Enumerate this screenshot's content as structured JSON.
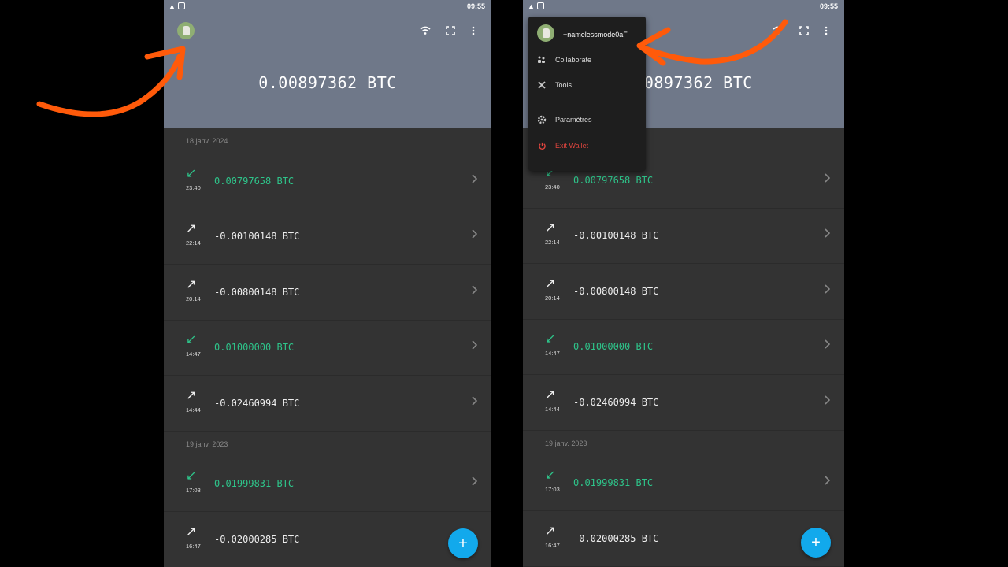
{
  "status_bar": {
    "time": "09:55"
  },
  "balance": "0.00897362 BTC",
  "transactions": [
    {
      "date": "18 janv. 2024"
    },
    {
      "direction": "in",
      "time": "23:40",
      "amount": "0.00797658 BTC"
    },
    {
      "direction": "out",
      "time": "22:14",
      "amount": "-0.00100148 BTC"
    },
    {
      "direction": "out",
      "time": "20:14",
      "amount": "-0.00800148 BTC"
    },
    {
      "direction": "in",
      "time": "14:47",
      "amount": "0.01000000 BTC"
    },
    {
      "direction": "out",
      "time": "14:44",
      "amount": "-0.02460994 BTC"
    },
    {
      "date": "19 janv. 2023"
    },
    {
      "direction": "in",
      "time": "17:03",
      "amount": "0.01999831 BTC"
    },
    {
      "direction": "out",
      "time": "16:47",
      "amount": "-0.02000285 BTC"
    }
  ],
  "menu": {
    "user": "+namelessmode0aF",
    "collaborate": "Collaborate",
    "tools": "Tools",
    "settings": "Paramètres",
    "exit": "Exit Wallet"
  },
  "fab_label": "+",
  "colors": {
    "header": "#6f7889",
    "incoming": "#2ec48a",
    "fab": "#12a9ec",
    "exit": "#e0453e",
    "annotation": "#ff5a0a"
  },
  "icons": [
    "warning-icon",
    "wifi-icon",
    "fullscreen-icon",
    "more-vert-icon",
    "arrow-in-icon",
    "arrow-out-icon",
    "chevron-right-icon",
    "collaborate-icon",
    "tools-icon",
    "gear-icon",
    "power-icon",
    "plus-icon"
  ]
}
